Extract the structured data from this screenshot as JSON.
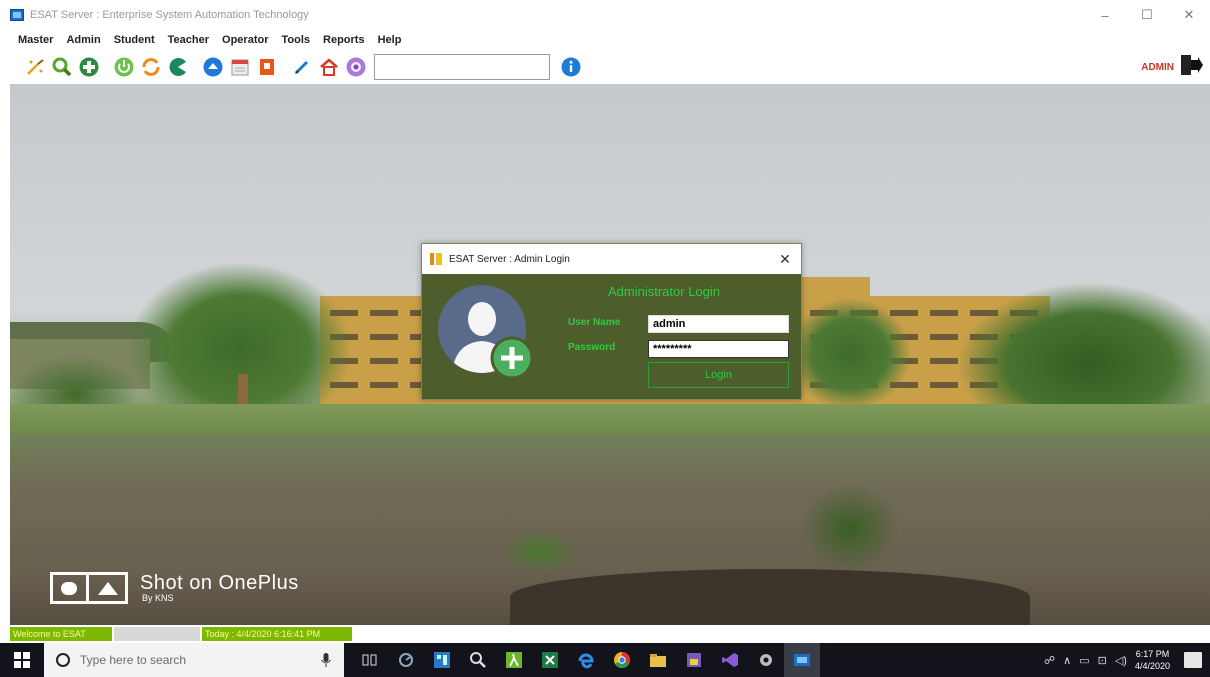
{
  "window": {
    "title": "ESAT Server : Enterprise System Automation Technology",
    "controls": {
      "minimize": "–",
      "maximize": "☐",
      "close": "✕"
    }
  },
  "menu": {
    "items": [
      "Master",
      "Admin",
      "Student",
      "Teacher",
      "Operator",
      "Tools",
      "Reports",
      "Help"
    ]
  },
  "toolbar": {
    "icons": [
      "wand-icon",
      "search-icon",
      "add-circle-icon",
      "power-icon",
      "refresh-icon",
      "pacman-icon",
      "up-arrow-circle-icon",
      "calendar-icon",
      "report-icon",
      "pencil-icon",
      "home-icon",
      "badge-icon",
      "info-icon"
    ],
    "search_value": "",
    "user_label": "ADMIN"
  },
  "background": {
    "watermark_main": "Shot on OnePlus",
    "watermark_sub": "By KNS"
  },
  "login_dialog": {
    "title": "ESAT Server : Admin Login",
    "close": "✕",
    "heading": "Administrator Login",
    "username_label": "User Name",
    "username_value": "admin",
    "password_label": "Password",
    "password_value": "*********",
    "login_button": "Login"
  },
  "statusbar": {
    "welcome": "Welcome to ESAT",
    "today": "Today : 4/4/2020 6:16:41 PM"
  },
  "taskbar": {
    "search_placeholder": "Type here to search",
    "time": "6:17 PM",
    "date": "4/4/2020"
  },
  "colors": {
    "dialog_bg": "#4d5d2c",
    "dialog_text": "#2ecc40",
    "status_green": "#7fb800",
    "taskbar": "#12131b"
  }
}
